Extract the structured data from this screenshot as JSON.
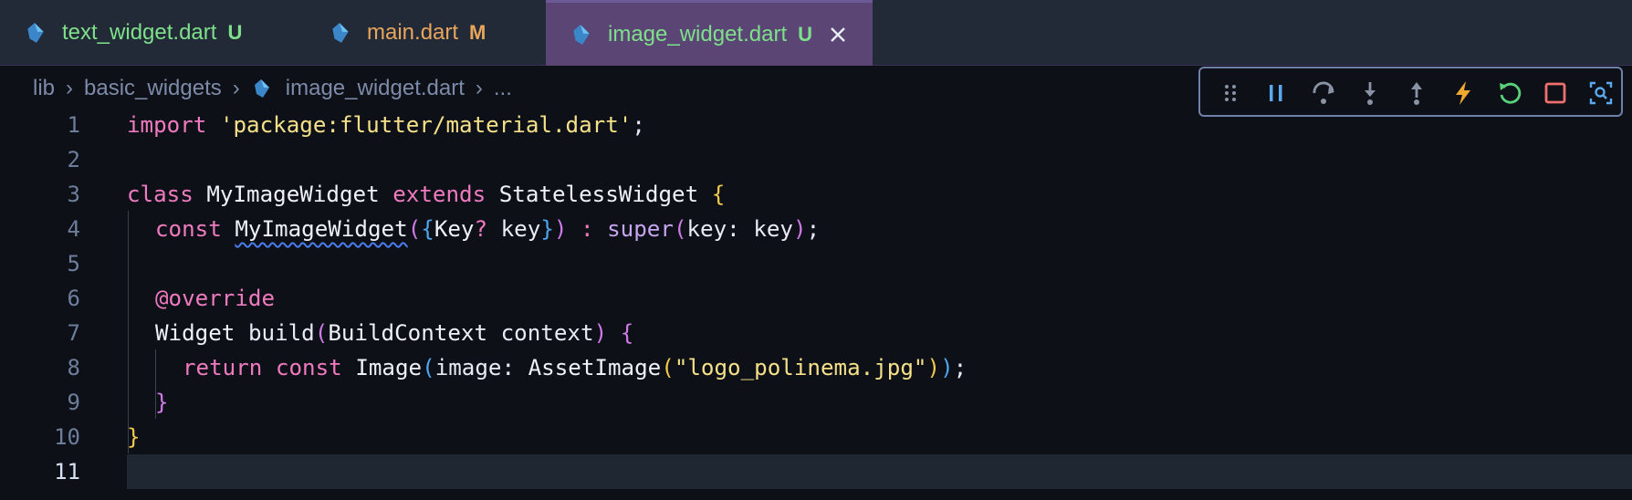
{
  "tabs": [
    {
      "label": "text_widget.dart",
      "status": "U",
      "color": "#7ee08a",
      "status_color": "#7ee08a"
    },
    {
      "label": "main.dart",
      "status": "M",
      "color": "#e8a55c",
      "status_color": "#e8a55c"
    },
    {
      "label": "image_widget.dart",
      "status": "U",
      "color": "#7ee08a",
      "status_color": "#7ee08a",
      "active": true
    }
  ],
  "breadcrumb": {
    "items": [
      "lib",
      "basic_widgets",
      "image_widget.dart",
      "..."
    ]
  },
  "debug_toolbar": {
    "buttons": [
      "drag-handle-icon",
      "pause-icon",
      "step-over-icon",
      "step-into-icon",
      "step-out-icon",
      "hot-reload-icon",
      "hot-restart-icon",
      "stop-icon",
      "inspect-widget-icon"
    ]
  },
  "editor": {
    "line_numbers": [
      "1",
      "2",
      "3",
      "4",
      "5",
      "6",
      "7",
      "8",
      "9",
      "10",
      "11"
    ],
    "current_line": "11",
    "lines": {
      "l1": {
        "import": "import",
        "str": "'package:flutter/material.dart'",
        "semi": ";"
      },
      "l3": {
        "class": "class",
        "name": "MyImageWidget",
        "extends": "extends",
        "base": "StatelessWidget",
        "brace": "{"
      },
      "l4": {
        "const": "const",
        "ctor": "MyImageWidget",
        "p1": "(",
        "b1": "{",
        "keytype": "Key",
        "q": "?",
        "key": "key",
        "b2": "}",
        "p2": ")",
        "colon": ":",
        "super": "super",
        "p3": "(",
        "named": "key:",
        "val": "key",
        "p4": ")",
        "semi": ";"
      },
      "l6": {
        "anno": "@override"
      },
      "l7": {
        "type": "Widget",
        "method": "build",
        "p1": "(",
        "ptype": "BuildContext",
        "pname": "context",
        "p2": ")",
        "brace": "{"
      },
      "l8": {
        "return": "return",
        "const": "const",
        "cls": "Image",
        "p1": "(",
        "named": "image:",
        "asset": "AssetImage",
        "p2": "(",
        "str": "\"logo_polinema.jpg\"",
        "p3": ")",
        "p4": ")",
        "semi": ";"
      },
      "l9": {
        "brace": "}"
      },
      "l10": {
        "brace": "}"
      }
    }
  }
}
